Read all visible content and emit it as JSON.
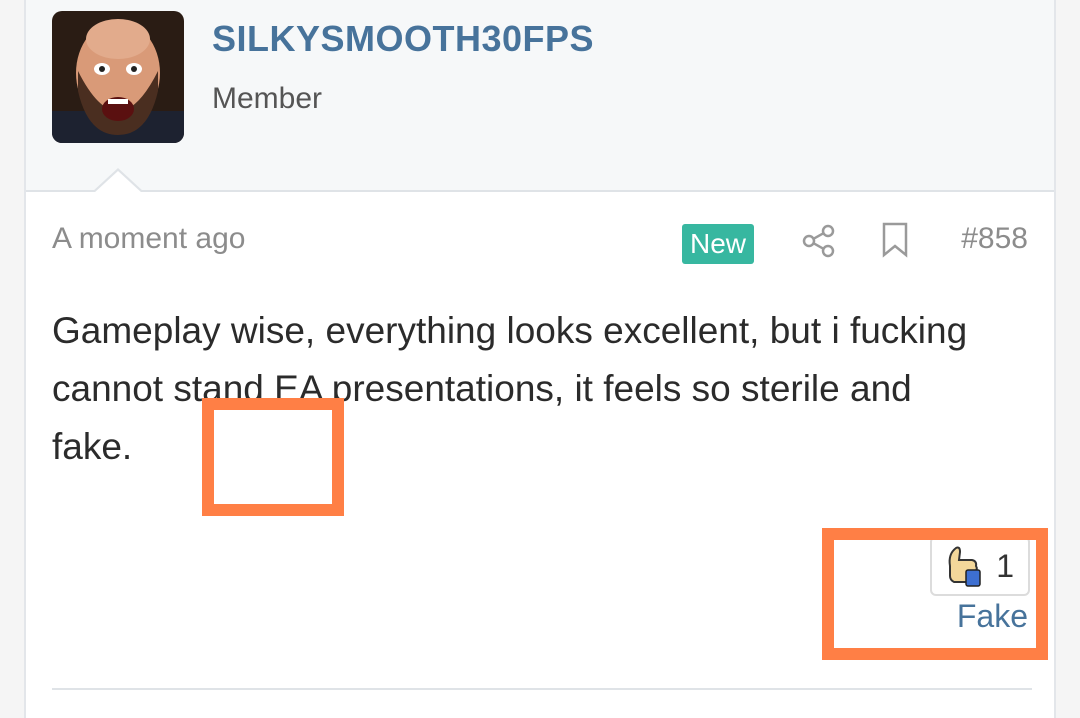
{
  "user": {
    "username": "SILKYSMOOTH30FPS",
    "title": "Member"
  },
  "post": {
    "timestamp": "A moment ago",
    "badge": "New",
    "number": "#858",
    "body": "Gameplay wise, everything looks excellent, but i fucking cannot stand EA presentations, it feels so sterile and fake."
  },
  "reaction": {
    "icon": "thumbs-up-icon",
    "count": "1",
    "label": "Fake"
  },
  "colors": {
    "username": "#47739b",
    "badge": "#37b7a0",
    "highlight": "#ff7f45"
  }
}
